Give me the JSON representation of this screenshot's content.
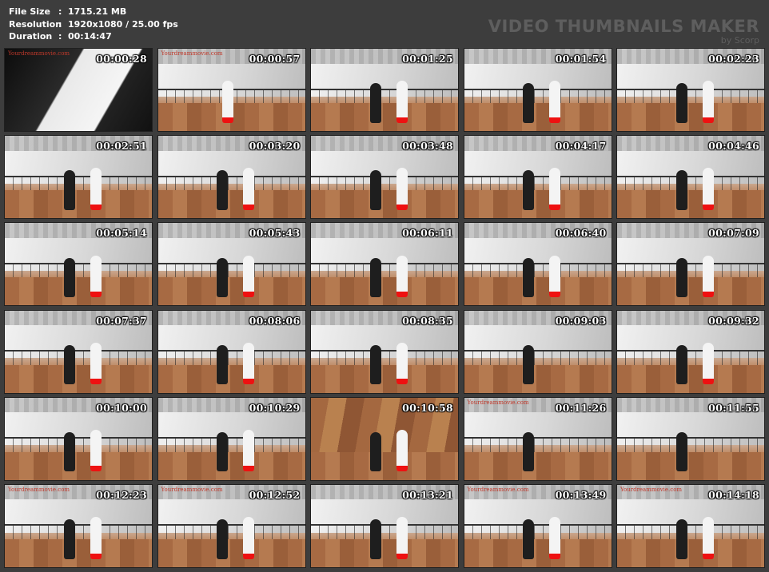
{
  "info": {
    "rows": [
      {
        "label": "File Size",
        "sep": ":",
        "value": "1715.21 MB"
      },
      {
        "label": "Resolution",
        "sep": ":",
        "value": "1920x1080 / 25.00 fps"
      },
      {
        "label": "Duration",
        "sep": ":",
        "value": "00:14:47"
      }
    ]
  },
  "watermark": {
    "title": "VIDEO THUMBNAILS MAKER",
    "by": "by Scorp"
  },
  "thumbnails": [
    {
      "time": "00:00:28",
      "site": "Yourdreammovie.com",
      "scene": "dark"
    },
    {
      "time": "00:00:57",
      "site": "Yourdreammovie.com",
      "scene": "white"
    },
    {
      "time": "00:01:25",
      "site": "",
      "scene": "both"
    },
    {
      "time": "00:01:54",
      "site": "",
      "scene": "both"
    },
    {
      "time": "00:02:23",
      "site": "",
      "scene": "both"
    },
    {
      "time": "00:02:51",
      "site": "",
      "scene": "both"
    },
    {
      "time": "00:03:20",
      "site": "",
      "scene": "both"
    },
    {
      "time": "00:03:48",
      "site": "",
      "scene": "both"
    },
    {
      "time": "00:04:17",
      "site": "",
      "scene": "both"
    },
    {
      "time": "00:04:46",
      "site": "",
      "scene": "both"
    },
    {
      "time": "00:05:14",
      "site": "",
      "scene": "both"
    },
    {
      "time": "00:05:43",
      "site": "",
      "scene": "both"
    },
    {
      "time": "00:06:11",
      "site": "",
      "scene": "both"
    },
    {
      "time": "00:06:40",
      "site": "",
      "scene": "both"
    },
    {
      "time": "00:07:09",
      "site": "",
      "scene": "both"
    },
    {
      "time": "00:07:37",
      "site": "",
      "scene": "both"
    },
    {
      "time": "00:08:06",
      "site": "",
      "scene": "both"
    },
    {
      "time": "00:08:35",
      "site": "",
      "scene": "both"
    },
    {
      "time": "00:09:03",
      "site": "",
      "scene": "dark-only"
    },
    {
      "time": "00:09:32",
      "site": "",
      "scene": "both"
    },
    {
      "time": "00:10:00",
      "site": "",
      "scene": "both"
    },
    {
      "time": "00:10:29",
      "site": "",
      "scene": "both"
    },
    {
      "time": "00:10:58",
      "site": "",
      "scene": "wood"
    },
    {
      "time": "00:11:26",
      "site": "Yourdreammovie.com",
      "scene": "dark-only"
    },
    {
      "time": "00:11:55",
      "site": "",
      "scene": "dark-only"
    },
    {
      "time": "00:12:23",
      "site": "Yourdreammovie.com",
      "scene": "both"
    },
    {
      "time": "00:12:52",
      "site": "Yourdreammovie.com",
      "scene": "both"
    },
    {
      "time": "00:13:21",
      "site": "",
      "scene": "both"
    },
    {
      "time": "00:13:49",
      "site": "Yourdreammovie.com",
      "scene": "both"
    },
    {
      "time": "00:14:18",
      "site": "Yourdreammovie.com",
      "scene": "both"
    }
  ]
}
